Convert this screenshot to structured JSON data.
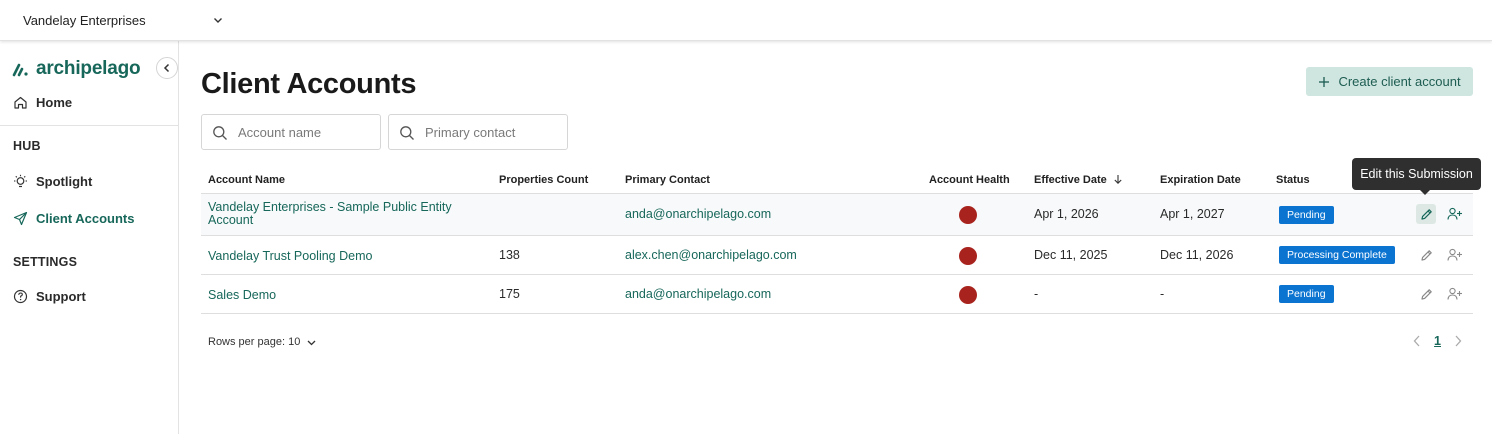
{
  "header": {
    "org_name": "Vandelay Enterprises"
  },
  "sidebar": {
    "logo_text": "archipelago",
    "home": "Home",
    "hub_section": "HUB",
    "spotlight": "Spotlight",
    "client_accounts": "Client Accounts",
    "settings_section": "SETTINGS",
    "support": "Support"
  },
  "main": {
    "title": "Client Accounts",
    "create_button": "Create client account",
    "search_account_placeholder": "Account name",
    "search_contact_placeholder": "Primary contact"
  },
  "table": {
    "columns": {
      "account_name": "Account Name",
      "properties_count": "Properties Count",
      "primary_contact": "Primary Contact",
      "account_health": "Account Health",
      "effective_date": "Effective Date",
      "expiration_date": "Expiration Date",
      "status": "Status"
    },
    "rows": [
      {
        "account_line1": "Vandelay Enterprises - Sample Public Entity",
        "account_line2": "Account",
        "properties": "",
        "contact": "anda@onarchipelago.com",
        "health": "#a8231d",
        "effective": "Apr 1, 2026",
        "expiration": "Apr 1, 2027",
        "status": "Pending"
      },
      {
        "account_line1": "Vandelay Trust Pooling Demo",
        "account_line2": "",
        "properties": "138",
        "contact": "alex.chen@onarchipelago.com",
        "health": "#a8231d",
        "effective": "Dec 11, 2025",
        "expiration": "Dec 11, 2026",
        "status": "Processing Complete"
      },
      {
        "account_line1": "Sales Demo",
        "account_line2": "",
        "properties": "175",
        "contact": "anda@onarchipelago.com",
        "health": "#a8231d",
        "effective": "-",
        "expiration": "-",
        "status": "Pending"
      }
    ]
  },
  "tooltip": {
    "text": "Edit this Submission"
  },
  "footer": {
    "rows_per_page": "Rows per page: 10",
    "current_page": "1"
  },
  "colors": {
    "brand": "#17675a",
    "status_badge": "#0b74d1",
    "health_red": "#a8231d"
  }
}
